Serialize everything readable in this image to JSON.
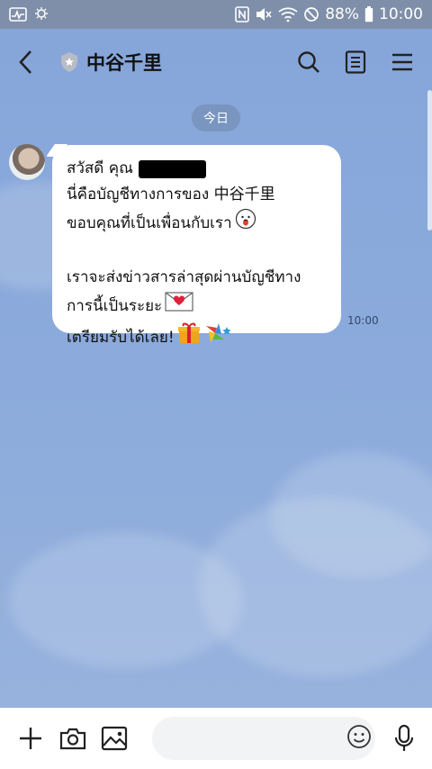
{
  "status": {
    "battery": "88%",
    "time": "10:00"
  },
  "header": {
    "title": "中谷千里"
  },
  "chat": {
    "date": "今日",
    "message": {
      "line1": "สวัสดี คุณ",
      "line2": "นี่คือบัญชีทางการของ 中谷千里",
      "line3": "ขอบคุณที่เป็นเพื่อนกับเรา",
      "line4": "เราจะส่งข่าวสารล่าสุดผ่านบัญชีทาง",
      "line5": "การนี้เป็นระยะ",
      "line6": "เตรียมรับได้เลย!",
      "time": "10:00"
    }
  },
  "composer": {
    "placeholder": ""
  },
  "colors": {
    "background": "#8aaad9",
    "statusbar": "#7f8fa9",
    "bubble": "#ffffff"
  },
  "icons": {
    "back": "chevron-left-icon",
    "official": "shield-icon",
    "search": "search-icon",
    "notes": "notes-icon",
    "menu": "menu-icon",
    "plus": "plus-icon",
    "camera": "camera-icon",
    "image": "image-icon",
    "emoji": "emoji-icon",
    "mic": "mic-icon"
  }
}
